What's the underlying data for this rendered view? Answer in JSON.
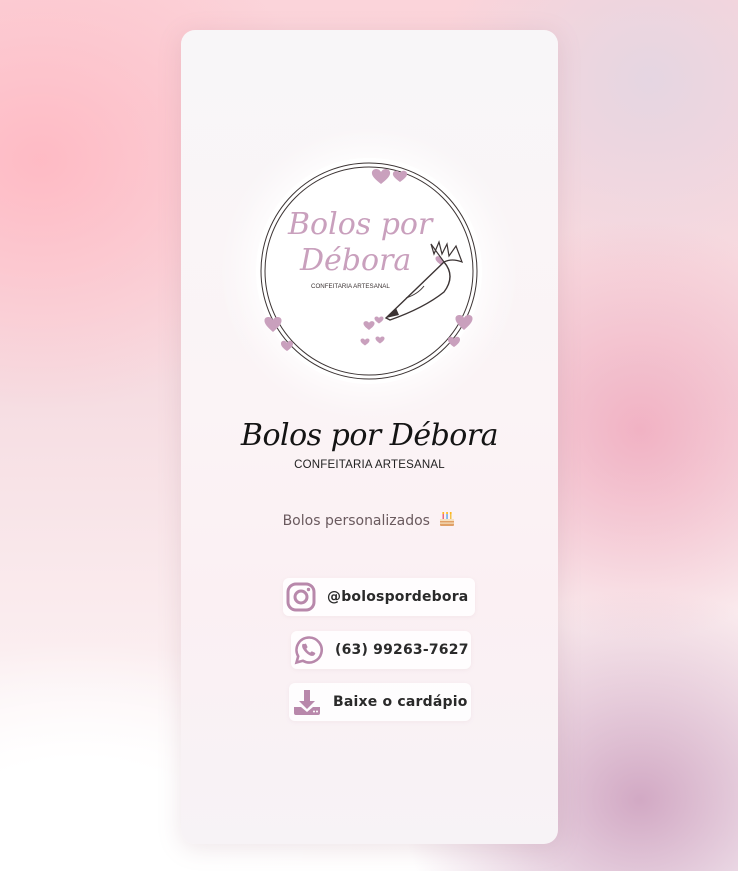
{
  "colors": {
    "accent": "#c9a0bd",
    "icon": "#b888ab",
    "title": "#141414"
  },
  "logo": {
    "script_line1": "Bolos por",
    "script_line2": "Débora",
    "small_text": "CONFEITARIA ARTESANAL"
  },
  "brand": {
    "title": "Bolos por Débora",
    "subtitle": "CONFEITARIA ARTESANAL"
  },
  "tagline": {
    "text": "Bolos personalizados",
    "icon": "birthday-cake-icon"
  },
  "links": [
    {
      "label": "@bolospordebora",
      "icon": "instagram-icon"
    },
    {
      "label": "(63) 99263-7627",
      "icon": "whatsapp-icon"
    },
    {
      "label": "Baixe o cardápio",
      "icon": "download-icon"
    }
  ]
}
